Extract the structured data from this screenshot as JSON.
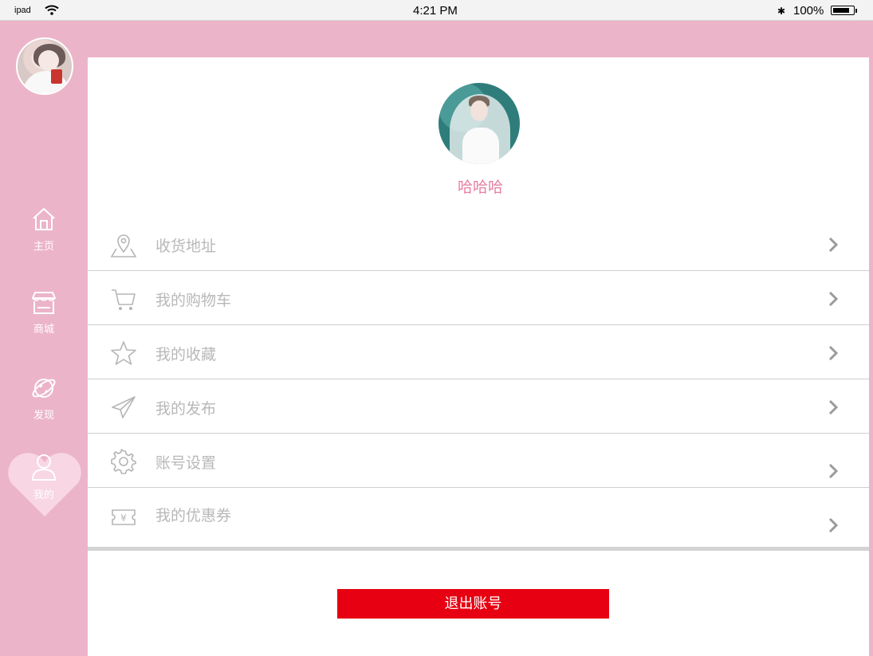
{
  "status_bar": {
    "device": "ipad",
    "time": "4:21 PM",
    "battery": "100%",
    "battery_level": 0.85
  },
  "sidebar": {
    "items": [
      {
        "label": "主页",
        "icon": "home-icon"
      },
      {
        "label": "商城",
        "icon": "store-icon"
      },
      {
        "label": "发现",
        "icon": "planet-icon"
      },
      {
        "label": "我的",
        "icon": "user-icon",
        "active": true
      }
    ]
  },
  "profile": {
    "username": "哈哈哈"
  },
  "menu": {
    "items": [
      {
        "label": "收货地址",
        "icon": "location-icon"
      },
      {
        "label": "我的购物车",
        "icon": "cart-icon"
      },
      {
        "label": "我的收藏",
        "icon": "star-icon"
      },
      {
        "label": "我的发布",
        "icon": "send-icon"
      },
      {
        "label": "账号设置",
        "icon": "gear-icon"
      },
      {
        "label": "我的优惠券",
        "icon": "coupon-icon"
      }
    ]
  },
  "logout_label": "退出账号",
  "colors": {
    "theme_pink": "#ecb4c9",
    "username_pink": "#e77fa2",
    "logout_red": "#e60012"
  }
}
